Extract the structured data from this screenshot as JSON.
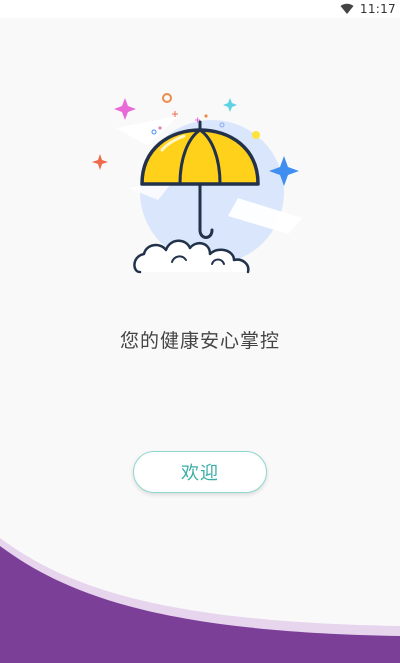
{
  "status_bar": {
    "time": "11:17",
    "wifi_icon": "wifi-icon"
  },
  "main": {
    "slogan": "您的健康安心掌控",
    "welcome_button_label": "欢迎",
    "illustration_icon": "umbrella-icon"
  },
  "colors": {
    "accent_teal": "#3aaea6",
    "button_border": "#8fd6d2",
    "bottom_purple": "#7b3f98",
    "umbrella_yellow": "#ffd11a",
    "sparkle_blue": "#3f8ef0",
    "sparkle_pink": "#e86ad8",
    "sparkle_orange": "#ef6a4a"
  }
}
